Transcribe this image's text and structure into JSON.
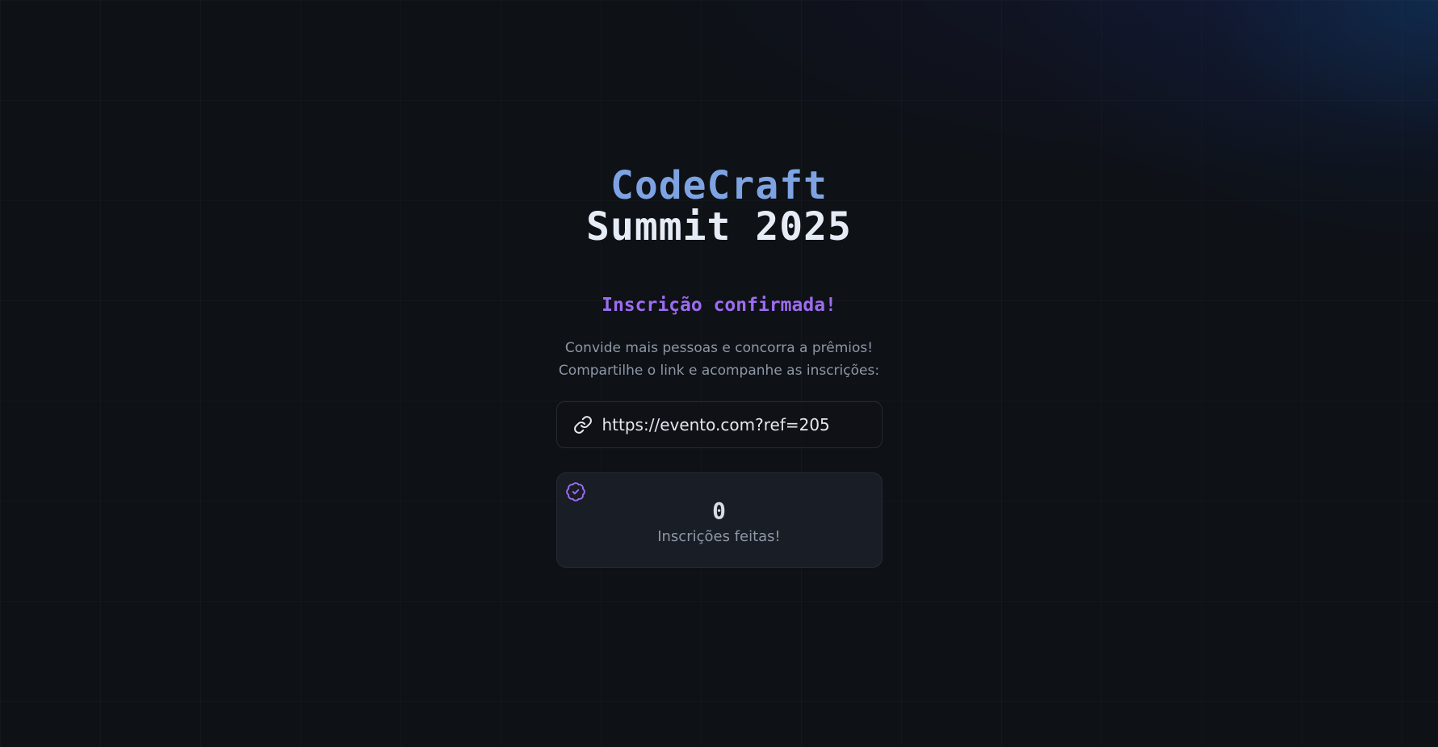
{
  "logo": {
    "line1": "CodeCraft",
    "line2": "Summit 2025"
  },
  "confirmation": {
    "title": "Inscrição confirmada!",
    "description_line1": "Convide mais pessoas e concorra a prêmios!",
    "description_line2": "Compartilhe o link e acompanhe as inscrições:"
  },
  "invite_link": {
    "icon": "link-icon",
    "url": "https://evento.com?ref=205"
  },
  "stats": {
    "icon": "verified-badge-icon",
    "count": "0",
    "label": "Inscrições feitas!"
  },
  "colors": {
    "background": "#0e1116",
    "logo_accent": "#7ea3e2",
    "logo_text": "#e6ecf5",
    "confirm_purple": "#9c6cf0",
    "muted_text": "#8e97a6",
    "card_bg": "#191d25"
  }
}
